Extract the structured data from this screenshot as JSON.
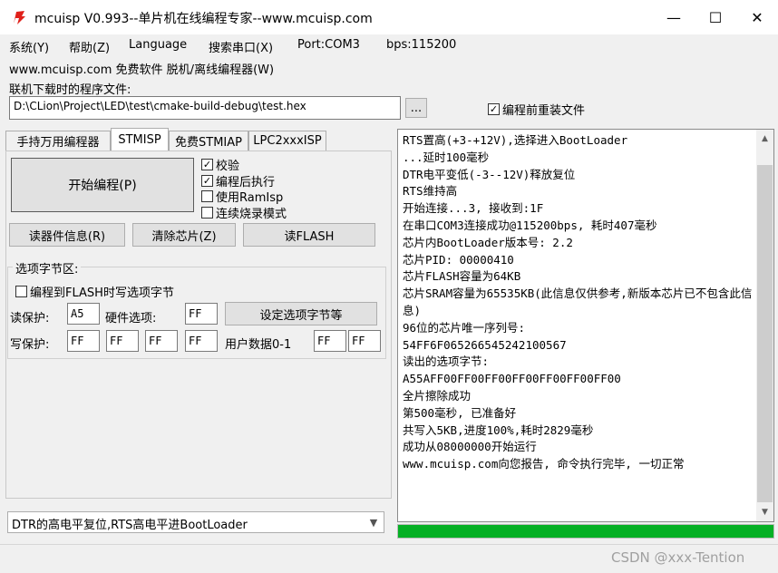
{
  "window": {
    "title": "mcuisp V0.993--单片机在线编程专家--www.mcuisp.com",
    "minimize": "—",
    "maximize": "☐",
    "close": "✕"
  },
  "menu": {
    "items": [
      "系统(Y)",
      "帮助(Z)",
      "Language",
      "搜索串口(X)",
      "Port:COM3",
      "bps:115200"
    ],
    "row2": "www.mcuisp.com 免费软件 脱机/离线编程器(W)"
  },
  "file": {
    "label": "联机下载时的程序文件:",
    "path": "D:\\CLion\\Project\\LED\\test\\cmake-build-debug\\test.hex",
    "browse": "...",
    "reload_label": "编程前重装文件",
    "reload_checked": true
  },
  "tabs": [
    "手持万用编程器",
    "STMISP",
    "免费STMIAP",
    "LPC2xxxISP"
  ],
  "active_tab": 1,
  "buttons": {
    "start": "开始编程(P)",
    "read_info": "读器件信息(R)",
    "erase": "清除芯片(Z)",
    "read_flash": "读FLASH",
    "set_option": "设定选项字节等"
  },
  "options": [
    {
      "label": "校验",
      "checked": true
    },
    {
      "label": "编程后执行",
      "checked": true
    },
    {
      "label": "使用RamIsp",
      "checked": false
    },
    {
      "label": "连续烧录模式",
      "checked": false
    }
  ],
  "option_bytes": {
    "title": "选项字节区:",
    "program_label": "编程到FLASH时写选项字节",
    "program_checked": false,
    "read_protect_label": "读保护:",
    "read_protect": "A5",
    "hw_option_label": "硬件选项:",
    "hw_option": "FF",
    "write_protect_label": "写保护:",
    "write_protect": [
      "FF",
      "FF",
      "FF",
      "FF"
    ],
    "user_data_label": "用户数据0-1",
    "user_data": [
      "FF",
      "FF"
    ]
  },
  "reset_mode": "DTR的高电平复位,RTS高电平进BootLoader",
  "log": [
    "RTS置高(+3-+12V),选择进入BootLoader",
    "...延时100毫秒",
    "DTR电平变低(-3--12V)释放复位",
    "RTS维持高",
    "开始连接...3, 接收到:1F",
    "在串口COM3连接成功@115200bps, 耗时407毫秒",
    "芯片内BootLoader版本号: 2.2",
    "芯片PID: 00000410",
    "芯片FLASH容量为64KB",
    "芯片SRAM容量为65535KB(此信息仅供参考,新版本芯片已不包含此信息)",
    "96位的芯片唯一序列号:",
    "54FF6F065266545242100567",
    "读出的选项字节:",
    "A55AFF00FF00FF00FF00FF00FF00FF00",
    "全片擦除成功",
    "第500毫秒, 已准备好",
    "共写入5KB,进度100%,耗时2829毫秒",
    "成功从08000000开始运行",
    "www.mcuisp.com向您报告, 命令执行完毕, 一切正常"
  ],
  "progress": 1.0,
  "watermark": "CSDN @xxx-Tention",
  "colors": {
    "accent_icon": "#e0201a",
    "progress": "#06b025"
  }
}
